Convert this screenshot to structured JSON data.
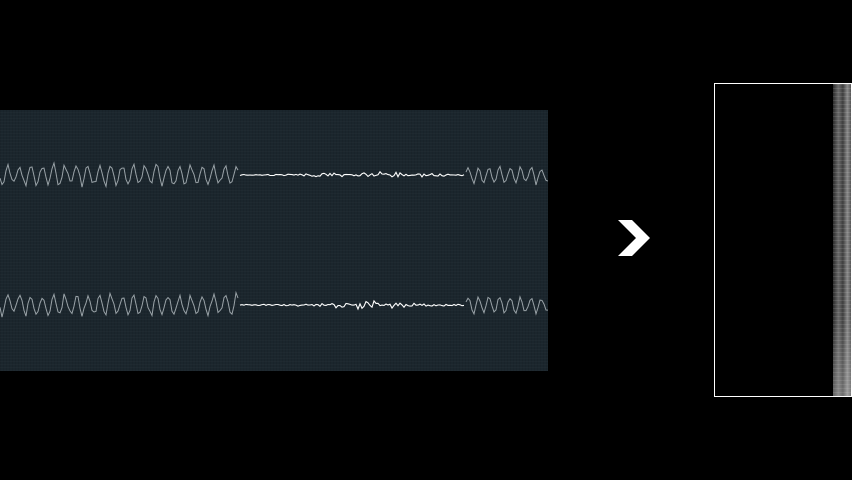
{
  "waveform": {
    "background_color": "#1b262d",
    "line_color": "#9aa3a8",
    "highlight_color": "#ffffff",
    "channel_count": 2
  },
  "transition": {
    "icon": "chevron-right-icon",
    "color": "#ffffff"
  },
  "spectrogram": {
    "frame_color": "#ffffff",
    "background_color": "#000000"
  }
}
